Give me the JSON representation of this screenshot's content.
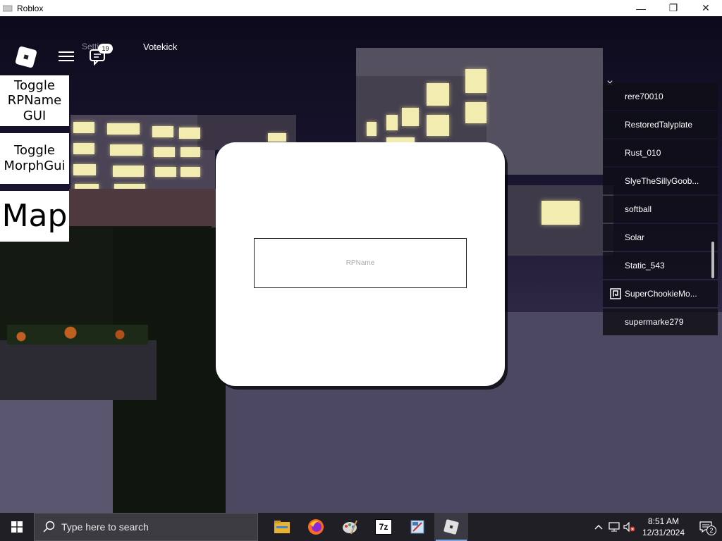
{
  "window": {
    "title": "Roblox",
    "controls": {
      "minimize": "—",
      "maximize": "❐",
      "close": "✕"
    }
  },
  "topbar": {
    "chat_badge": "19",
    "settings_label": "Settings",
    "votekick_label": "Votekick"
  },
  "left_buttons": {
    "toggle_rpname": "Toggle RPName GUI",
    "toggle_morph": "Toggle MorphGui",
    "map": "Map"
  },
  "dialog": {
    "input_placeholder": "RPName",
    "input_value": ""
  },
  "player_list": {
    "close_glyph": "×",
    "players": [
      {
        "name": "rere70010",
        "icon": ""
      },
      {
        "name": "RestoredTalyplate",
        "icon": ""
      },
      {
        "name": "Rust_010",
        "icon": ""
      },
      {
        "name": "SlyeTheSillyGoob...",
        "icon": ""
      },
      {
        "name": "softball",
        "icon": ""
      },
      {
        "name": "Solar",
        "icon": ""
      },
      {
        "name": "Static_543",
        "icon": ""
      },
      {
        "name": "SuperChookieMo...",
        "icon": "premium-icon"
      },
      {
        "name": "supermarke279",
        "icon": ""
      }
    ]
  },
  "taskbar": {
    "search_placeholder": "Type here to search",
    "apps": [
      "file-explorer-icon",
      "firefox-icon",
      "paint-icon",
      "7zip-icon",
      "snipping-tool-icon",
      "roblox-icon"
    ],
    "seven_zip_label": "7z",
    "clock_time": "8:51 AM",
    "clock_date": "12/31/2024",
    "notification_count": "2"
  },
  "colors": {
    "sky_top": "#0d0a1c",
    "window_light": "#f3ecb0",
    "taskbar_bg": "#1f1f25",
    "dialog_bg": "#ffffff"
  }
}
